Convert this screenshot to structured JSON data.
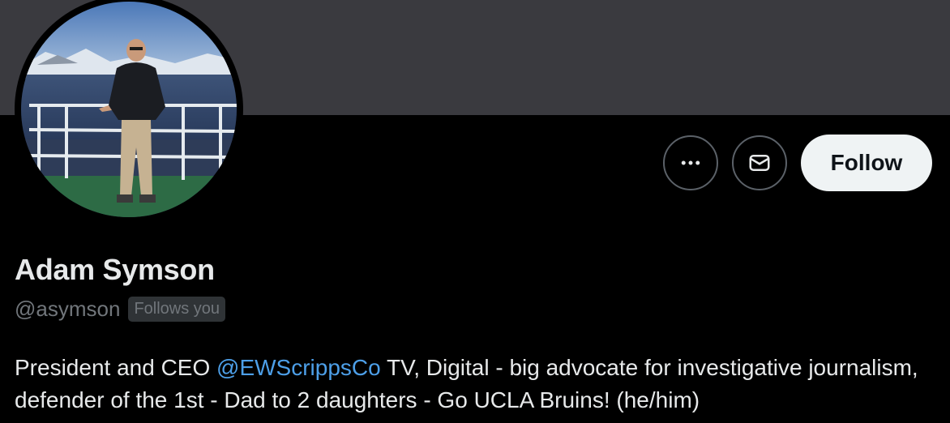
{
  "profile": {
    "display_name": "Adam Symson",
    "handle": "@asymson",
    "follows_you_badge": "Follows you",
    "bio": {
      "before_mention": "President and CEO ",
      "mention": "@EWScrippsCo",
      "after_mention": " TV, Digital - big advocate for investigative journalism, defender of the 1st - Dad to 2 daughters - Go UCLA Bruins! (he/him)"
    }
  },
  "actions": {
    "more_icon": "more-horizontal-icon",
    "message_icon": "envelope-icon",
    "follow_label": "Follow"
  },
  "colors": {
    "background": "#000000",
    "banner": "#3a3a3f",
    "text_primary": "#e7e9ea",
    "text_secondary": "#71767b",
    "link": "#4d9fe8",
    "follow_button_bg": "#eff3f4",
    "button_border": "#5b6168"
  }
}
